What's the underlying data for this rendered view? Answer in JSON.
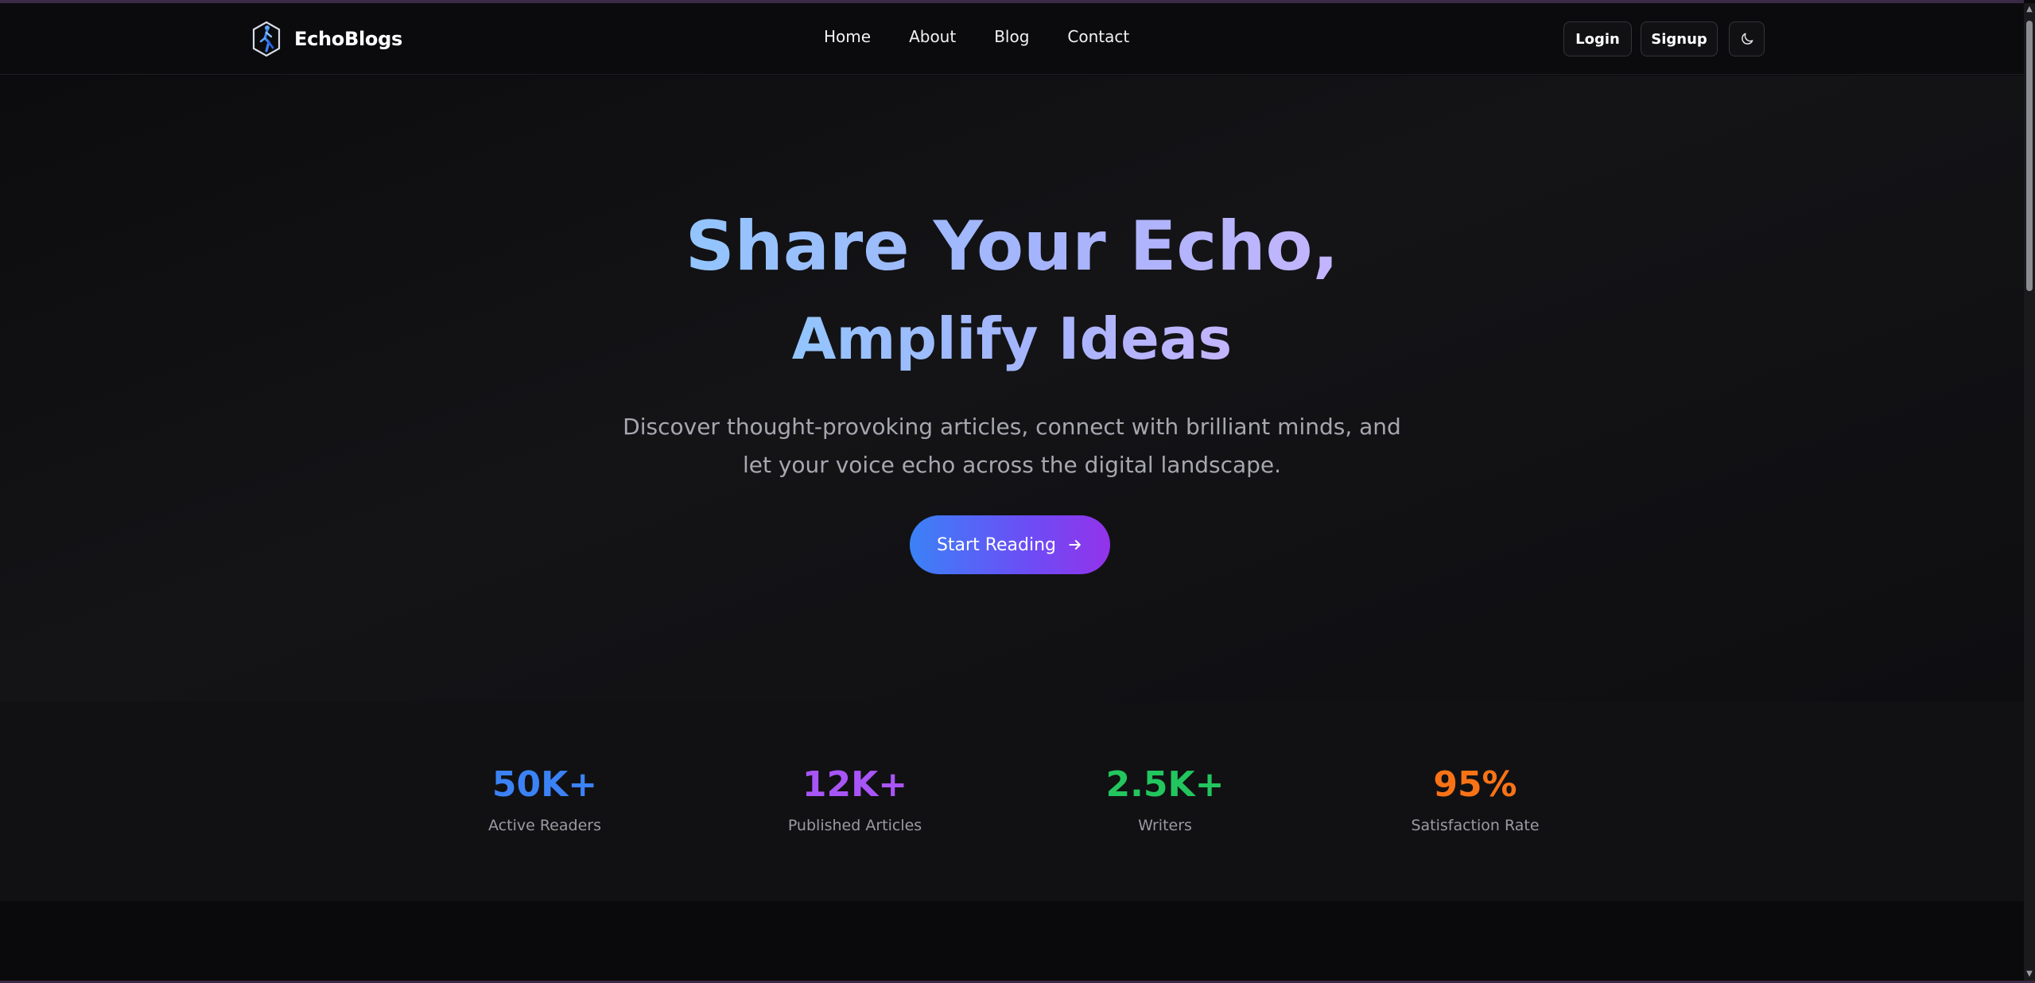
{
  "brand": {
    "name": "EchoBlogs",
    "logo_icon": "runner-hexagon-icon"
  },
  "nav": {
    "items": [
      {
        "label": "Home"
      },
      {
        "label": "About"
      },
      {
        "label": "Blog"
      },
      {
        "label": "Contact"
      }
    ]
  },
  "auth": {
    "login_label": "Login",
    "signup_label": "Signup",
    "theme_icon": "moon-icon"
  },
  "hero": {
    "title_line1": "Share Your Echo,",
    "title_line2": "Amplify Ideas",
    "subtitle_line1": "Discover thought-provoking articles, connect with brilliant minds, and",
    "subtitle_line2": "let your voice echo across the digital landscape.",
    "cta_label": "Start Reading",
    "cta_icon": "arrow-right-icon"
  },
  "stats": [
    {
      "value": "50K+",
      "label": "Active Readers",
      "color": "#3b82f6"
    },
    {
      "value": "12K+",
      "label": "Published Articles",
      "color": "#a855f7"
    },
    {
      "value": "2.5K+",
      "label": "Writers",
      "color": "#22c55e"
    },
    {
      "value": "95%",
      "label": "Satisfaction Rate",
      "color": "#f97316"
    }
  ],
  "colors": {
    "cta_gradient_start": "#3b82f6",
    "cta_gradient_end": "#9333ea",
    "title_gradient_start": "#93c5fd",
    "title_gradient_end": "#c4b5fd"
  }
}
